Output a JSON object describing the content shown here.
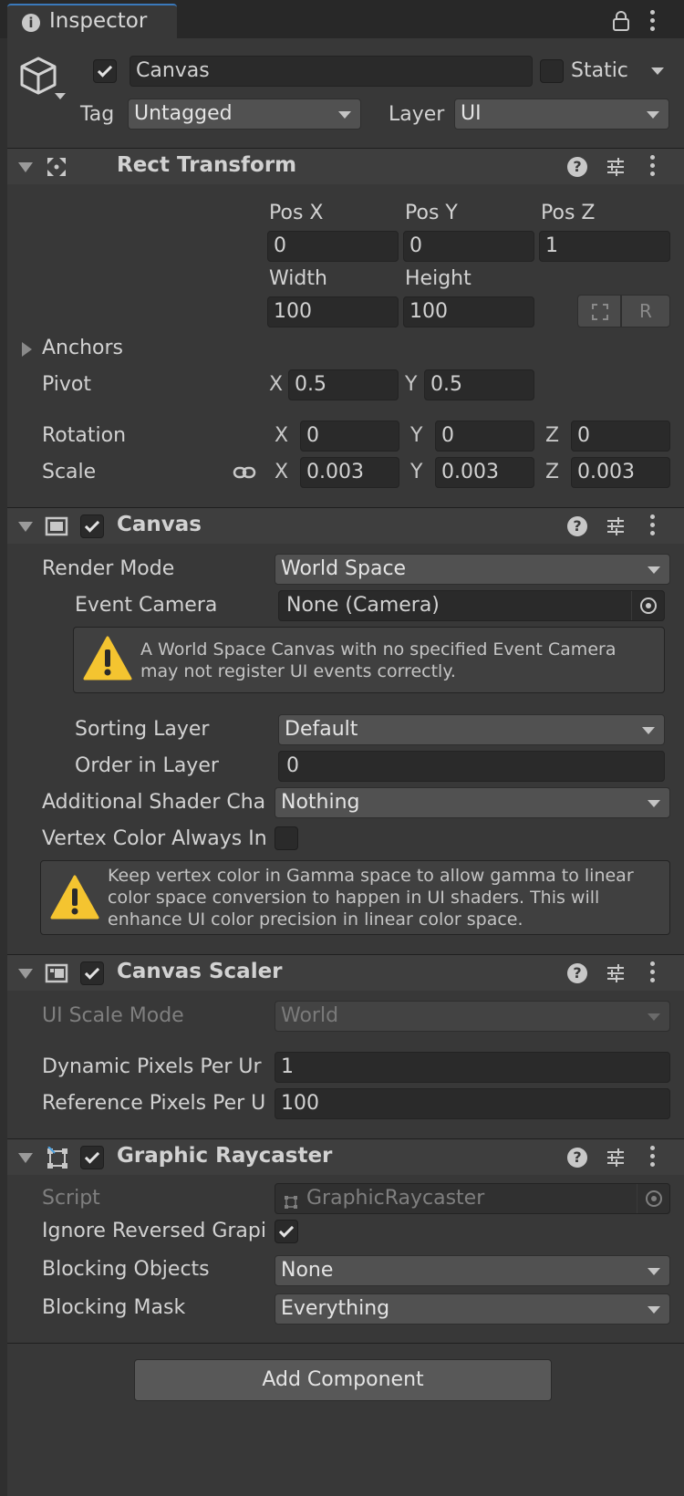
{
  "tab": {
    "title": "Inspector"
  },
  "object": {
    "name": "Canvas",
    "active": true,
    "static_label": "Static",
    "tag_label": "Tag",
    "tag_value": "Untagged",
    "layer_label": "Layer",
    "layer_value": "UI"
  },
  "rect_transform": {
    "title": "Rect Transform",
    "posx_label": "Pos X",
    "posy_label": "Pos Y",
    "posz_label": "Pos Z",
    "posx": "0",
    "posy": "0",
    "posz": "1",
    "width_label": "Width",
    "height_label": "Height",
    "width": "100",
    "height": "100",
    "raw_button": "R",
    "anchors_label": "Anchors",
    "pivot_label": "Pivot",
    "pivot_x": "0.5",
    "pivot_y": "0.5",
    "rotation_label": "Rotation",
    "rot_x": "0",
    "rot_y": "0",
    "rot_z": "0",
    "scale_label": "Scale",
    "scale_x": "0.003",
    "scale_y": "0.003",
    "scale_z": "0.003",
    "x": "X",
    "y": "Y",
    "z": "Z"
  },
  "canvas": {
    "title": "Canvas",
    "render_mode_label": "Render Mode",
    "render_mode": "World Space",
    "event_camera_label": "Event Camera",
    "event_camera": "None (Camera)",
    "warning1_line1": "A World Space Canvas with no specified Event Camera",
    "warning1_line2": "may not register UI events correctly.",
    "sorting_layer_label": "Sorting Layer",
    "sorting_layer": "Default",
    "order_label": "Order in Layer",
    "order": "0",
    "shader_label": "Additional Shader Cha",
    "shader_value": "Nothing",
    "vertex_label": "Vertex Color Always In",
    "warning2_line1": "Keep vertex color in Gamma space to allow gamma to linear",
    "warning2_line2": "color space conversion to happen in UI shaders. This will",
    "warning2_line3": "enhance UI color precision in linear color space."
  },
  "scaler": {
    "title": "Canvas Scaler",
    "mode_label": "UI Scale Mode",
    "mode": "World",
    "dynamic_label": "Dynamic Pixels Per Ur",
    "dynamic": "1",
    "reference_label": "Reference Pixels Per U",
    "reference": "100"
  },
  "raycaster": {
    "title": "Graphic Raycaster",
    "script_label": "Script",
    "script": "GraphicRaycaster",
    "ignore_label": "Ignore Reversed Grapi",
    "blocking_objects_label": "Blocking Objects",
    "blocking_objects": "None",
    "blocking_mask_label": "Blocking Mask",
    "blocking_mask": "Everything"
  },
  "add_component": "Add Component",
  "colors": {
    "panel": "#383838",
    "header": "#3e3e3e",
    "field": "#2a2a2a",
    "dropdown": "#515151",
    "warning": "#f4c430"
  }
}
